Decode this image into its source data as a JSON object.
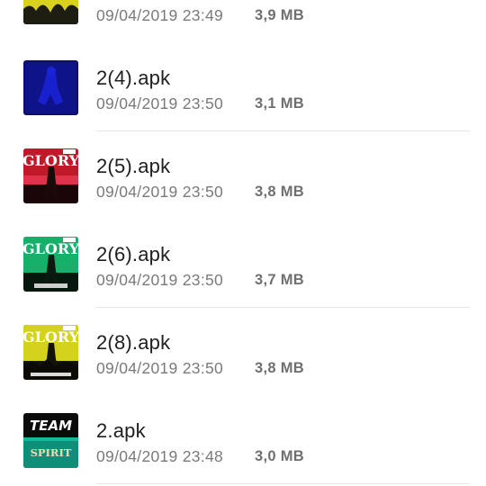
{
  "files": [
    {
      "name": "",
      "date": "09/04/2019 23:49",
      "size": "3,9 MB",
      "icon": "app-icon-yellow-partial"
    },
    {
      "name": "2(4).apk",
      "date": "09/04/2019 23:50",
      "size": "3,1 MB",
      "icon": "app-icon-blue-figure"
    },
    {
      "name": "2(5).apk",
      "date": "09/04/2019 23:50",
      "size": "3,8 MB",
      "icon": "app-icon-glory-red"
    },
    {
      "name": "2(6).apk",
      "date": "09/04/2019 23:50",
      "size": "3,7 MB",
      "icon": "app-icon-glory-green"
    },
    {
      "name": "2(8).apk",
      "date": "09/04/2019 23:50",
      "size": "3,8 MB",
      "icon": "app-icon-glory-yellow"
    },
    {
      "name": "2.apk",
      "date": "09/04/2019 23:48",
      "size": "3,0 MB",
      "icon": "app-icon-team-spirit"
    }
  ],
  "thumb_text": {
    "glory": "GLORY",
    "team": "TEAM",
    "spirit": "SPIRIT"
  },
  "colors": {
    "name_text": "#202020",
    "meta_text": "#7a7a7a",
    "divider": "#e6e6e6"
  }
}
